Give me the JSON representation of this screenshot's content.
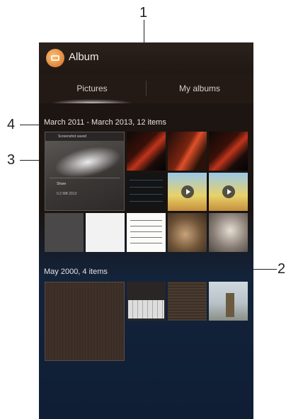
{
  "callouts": [
    "1",
    "2",
    "3",
    "4"
  ],
  "app": {
    "title": "Album",
    "icon": "album-app-icon"
  },
  "tabs": [
    {
      "label": "Pictures",
      "selected": true
    },
    {
      "label": "My albums",
      "selected": false
    }
  ],
  "sections": [
    {
      "header": "March 2011 - March 2013, 12 items"
    },
    {
      "header": "May 2000, 4 items"
    }
  ],
  "thumbnail": {
    "title": "Screenshot saved",
    "share": "Share",
    "info": "0.2 MB 2013"
  },
  "colors": {
    "accent": "#e2843a",
    "actionbar": "#201814",
    "background_bottom": "#0f1e35"
  }
}
